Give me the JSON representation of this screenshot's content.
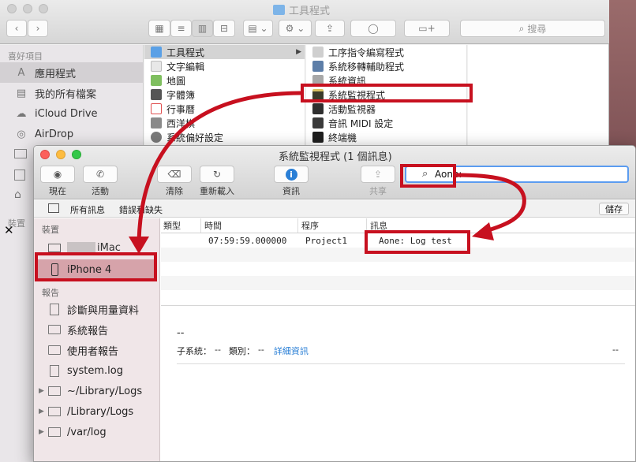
{
  "finder": {
    "title": "工具程式",
    "search_placeholder": "搜尋",
    "sidebar": {
      "favorites_header": "喜好項目",
      "items": [
        {
          "label": "應用程式",
          "icon": "applications-icon"
        },
        {
          "label": "我的所有檔案",
          "icon": "all-files-icon"
        },
        {
          "label": "iCloud Drive",
          "icon": "cloud-icon"
        },
        {
          "label": "AirDrop",
          "icon": "airdrop-icon"
        }
      ],
      "devices_header_partial": "裝置"
    },
    "col1": [
      {
        "label": "工具程式",
        "color": "#5aa0e6"
      },
      {
        "label": "文字編輯",
        "color": "#e8e8e8"
      },
      {
        "label": "地圖",
        "color": "#7fbf5f"
      },
      {
        "label": "字體簿",
        "color": "#555555"
      },
      {
        "label": "行事曆",
        "color": "#e05050"
      },
      {
        "label": "西洋棋",
        "color": "#8a8a8a"
      },
      {
        "label": "系統偏好設定",
        "color": "#7a7a7a"
      }
    ],
    "col2": [
      {
        "label": "工序指令編寫程式",
        "color": "#cfcfcf"
      },
      {
        "label": "系統移轉輔助程式",
        "color": "#5d7ea8"
      },
      {
        "label": "系統資訊",
        "color": "#a8a8a8"
      },
      {
        "label": "系統監視程式",
        "color": "#3b3b2a"
      },
      {
        "label": "活動監視器",
        "color": "#2f2f2f"
      },
      {
        "label": "音訊 MIDI 設定",
        "color": "#3a3a3a"
      },
      {
        "label": "終端機",
        "color": "#1e1e1e"
      }
    ]
  },
  "console": {
    "title": "系統監視程式 (1 個訊息)",
    "toolbar": {
      "now": "現在",
      "activity": "活動",
      "clear": "清除",
      "reload": "重新載入",
      "info": "資訊",
      "share": "共享",
      "search_value": "Aone:"
    },
    "filters": {
      "all": "所有訊息",
      "errors": "錯誤和缺失",
      "save": "儲存"
    },
    "sidebar": {
      "devices_header": "裝置",
      "devices": [
        {
          "label": "iMac",
          "icon": "imac-icon"
        },
        {
          "label": "iPhone 4",
          "icon": "iphone-icon"
        }
      ],
      "reports_header": "報告",
      "reports": [
        {
          "label": "診斷與用量資料",
          "icon": "document-icon",
          "disclosure": false
        },
        {
          "label": "系統報告",
          "icon": "folder-icon",
          "disclosure": false
        },
        {
          "label": "使用者報告",
          "icon": "folder-icon",
          "disclosure": false
        },
        {
          "label": "system.log",
          "icon": "document-icon",
          "disclosure": false
        },
        {
          "label": "~/Library/Logs",
          "icon": "folder-icon",
          "disclosure": true
        },
        {
          "label": "/Library/Logs",
          "icon": "folder-icon",
          "disclosure": true
        },
        {
          "label": "/var/log",
          "icon": "folder-icon",
          "disclosure": true
        }
      ]
    },
    "table": {
      "columns": [
        "類型",
        "時間",
        "程序",
        "訊息"
      ],
      "rows": [
        {
          "type": "",
          "time": "07:59:59.000000",
          "process": "Project1",
          "message": "Aone: Log test"
        }
      ]
    },
    "detail": {
      "dash": "--",
      "subsystem_label": "子系統：",
      "subsystem_value": "--",
      "category_label": "類別：",
      "category_value": "--",
      "details_link": "詳細資訊",
      "right_dash": "--"
    }
  },
  "colors": {
    "annotation_red": "#c7101f",
    "link_blue": "#2a7fd6",
    "focus_blue": "#5b9cf0"
  }
}
